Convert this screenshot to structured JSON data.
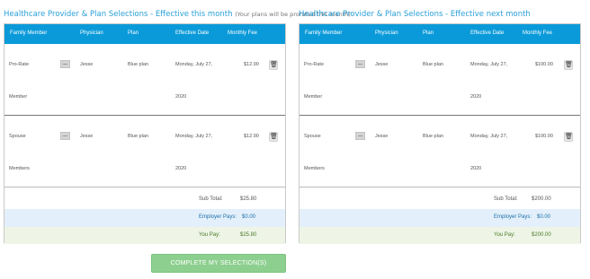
{
  "left_panel": {
    "title": "Healthcare Provider & Plan Selections - Effective this month",
    "note": "(Your plans will be prorated this month)",
    "headers": [
      "Family Member",
      "Physician",
      "Plan",
      "Effective Date",
      "Monthly Fee"
    ],
    "rows": [
      {
        "member_line1": "Pro-Rate",
        "member_line2": "Member",
        "physician": "Jesse",
        "plan": "Blue plan",
        "date_line1": "Monday, July 27,",
        "date_line2": "2020",
        "fee": "$12.90"
      },
      {
        "member_line1": "Spouse",
        "member_line2": "Members",
        "physician": "Jesse",
        "plan": "Blue plan",
        "date_line1": "Monday, July 27,",
        "date_line2": "2020",
        "fee": "$12.90"
      }
    ],
    "subtotal_label": "Sub Total:",
    "subtotal_value": "$25.80",
    "employer_label": "Employer Pays:",
    "employer_value": "$0.00",
    "you_pay_label": "You Pay:",
    "you_pay_value": "$25.80"
  },
  "right_panel": {
    "title": "Healthcare Provider & Plan Selections - Effective next month",
    "headers": [
      "Family Member",
      "Physician",
      "Plan",
      "Effective Date",
      "Monthly Fee"
    ],
    "rows": [
      {
        "member_line1": "Pro-Rate",
        "member_line2": "Member",
        "physician": "Jesse",
        "plan": "Blue plan",
        "date_line1": "Monday, July 27,",
        "date_line2": "2020",
        "fee": "$100.00"
      },
      {
        "member_line1": "Spouse",
        "member_line2": "Members",
        "physician": "Jesse",
        "plan": "Blue plan",
        "date_line1": "Monday, July 27,",
        "date_line2": "2020",
        "fee": "$100.00"
      }
    ],
    "subtotal_label": "Sub Total:",
    "subtotal_value": "$200.00",
    "employer_label": "Employer Pays:",
    "employer_value": "$0.00",
    "you_pay_label": "You Pay:",
    "you_pay_value": "$200.00"
  },
  "complete_button_label": "COMPLETE MY SELECTION(S)",
  "icons": {
    "physician_thumbnail": "image-placeholder-icon",
    "delete": "trash-icon"
  },
  "colors": {
    "header_bg": "#0a9ad9",
    "title": "#2aa0d8",
    "employer_bg": "#e3f0fb",
    "you_pay_bg": "#eef5e6",
    "button_bg": "#8dcf8f"
  }
}
